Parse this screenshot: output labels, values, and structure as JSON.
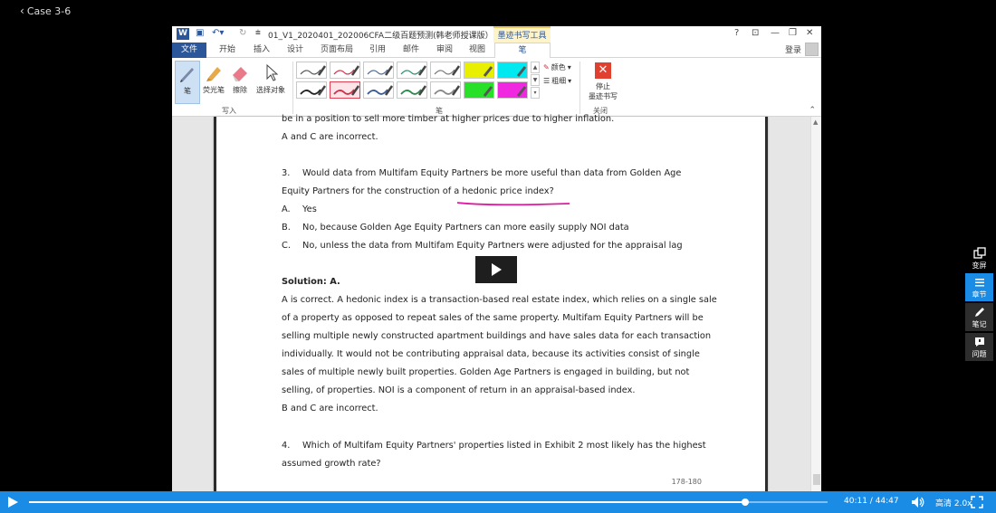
{
  "topbar": {
    "back_label": "Case 3-6"
  },
  "word": {
    "doc_title": "01_V1_2020401_202006CFA二级百题预测(韩老师授课版） - ...",
    "ink_tools_label": "墨迹书写工具",
    "window_controls": [
      "?",
      "⊡",
      "—",
      "❐",
      "✕"
    ],
    "login_label": "登录",
    "tabs": [
      "文件",
      "开始",
      "插入",
      "设计",
      "页面布局",
      "引用",
      "邮件",
      "审阅",
      "视图",
      "笔"
    ],
    "ribbon": {
      "write_buttons": [
        {
          "label": "笔",
          "icon": "pen-icon"
        },
        {
          "label": "荧光笔",
          "icon": "highlighter-icon"
        },
        {
          "label": "擦除",
          "icon": "eraser-icon"
        },
        {
          "label": "选择对象",
          "icon": "select-pointer-icon"
        }
      ],
      "write_group_label": "写入",
      "pens_group_label": "笔",
      "color_label": "颜色",
      "thickness_label": "粗细",
      "stop_label_1": "停止",
      "stop_label_2": "墨迹书写",
      "close_group_label": "关闭",
      "pen_swatches_row1": [
        "#555555",
        "#d0304a",
        "#4a6a9a",
        "#2a8a6a",
        "#777777",
        "#e8f000",
        "#00e8f0"
      ],
      "pen_swatches_row2": [
        "#222222",
        "#d0304a",
        "#3a5a9a",
        "#2a8a4a",
        "#888888",
        "#28e028",
        "#f028e0"
      ]
    }
  },
  "document": {
    "lines": [
      "be in a position to sell more timber at higher prices due to higher inflation.",
      "A and C are incorrect.",
      "Would data from Multifam Equity Partners be more useful than data from Golden Age",
      "Equity Partners for the construction of a ",
      "hedonic price index?",
      "Yes",
      "No, because Golden Age Equity Partners can more easily supply NOI data",
      "No, unless the data from Multifam Equity Partners were adjusted for the appraisal lag",
      "Solution: A.",
      "A is correct. A hedonic index is a transaction-based real estate index, which relies on a single sale",
      "of a property as opposed to repeat sales of the same property. Multifam Equity Partners will be",
      "selling multiple newly constructed apartment buildings and have sales data for each transaction",
      "individually. It would not be contributing appraisal data, because its activities consist of single",
      "sales of multiple newly built properties. Golden Age Partners is engaged in building, but not",
      "selling, of properties. NOI is a component of return in an appraisal-based index.",
      "B and C are incorrect.",
      "Which of Multifam Equity Partners' properties listed in Exhibit 2 most likely has the highest",
      "assumed growth rate?"
    ],
    "q3_number": "3.",
    "q4_number": "4.",
    "option_a": "A.",
    "option_b": "B.",
    "option_c": "C.",
    "page_number": "178-180"
  },
  "side_panel": [
    {
      "label": "变屏",
      "icon": "switch-screen-icon"
    },
    {
      "label": "章节",
      "icon": "chapters-icon"
    },
    {
      "label": "笔记",
      "icon": "notes-icon"
    },
    {
      "label": "问题",
      "icon": "questions-icon"
    }
  ],
  "player": {
    "time_text": "40:11 / 44:47",
    "progress_fraction": 0.897,
    "quality_label": "高清 2.0x"
  }
}
